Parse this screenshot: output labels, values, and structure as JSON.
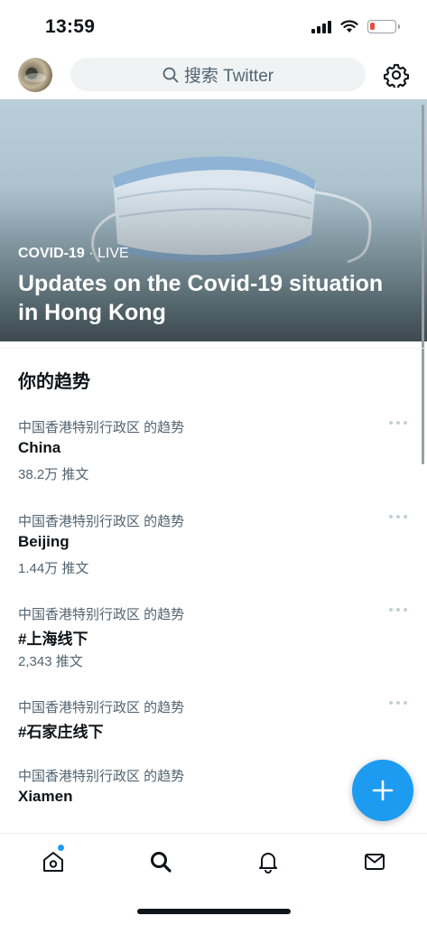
{
  "status_bar": {
    "time": "13:59",
    "battery_level": 0.18,
    "icons": [
      "cellular-signal-icon",
      "wifi-icon",
      "battery-icon"
    ]
  },
  "top_nav": {
    "avatar": "profile-avatar",
    "search_placeholder": "搜索 Twitter",
    "settings_icon": "gear-icon"
  },
  "hero": {
    "category": "COVID-19",
    "separator": " · ",
    "status": "LIVE",
    "title": "Updates on the Covid-19 situation in Hong Kong"
  },
  "trends": {
    "section_title": "你的趋势",
    "items": [
      {
        "context": "中国香港特别行政区 的趋势",
        "name": "China",
        "count": "38.2万 推文"
      },
      {
        "context": "中国香港特别行政区 的趋势",
        "name": "Beijing",
        "count": "1.44万 推文"
      },
      {
        "context": "中国香港特别行政区 的趋势",
        "name": "#上海线下",
        "count": "2,343 推文"
      },
      {
        "context": "中国香港特别行政区 的趋势",
        "name": "#石家庄线下",
        "count": ""
      },
      {
        "context": "中国香港特别行政区 的趋势",
        "name": "Xiamen",
        "count": ""
      }
    ]
  },
  "fab": {
    "icon": "plus-icon"
  },
  "tab_bar": {
    "items": [
      "home-icon",
      "search-icon",
      "bell-icon",
      "mail-icon"
    ],
    "active": "search"
  },
  "colors": {
    "accent": "#1d9bf0",
    "text_primary": "#0f1419",
    "text_secondary": "#536471"
  }
}
